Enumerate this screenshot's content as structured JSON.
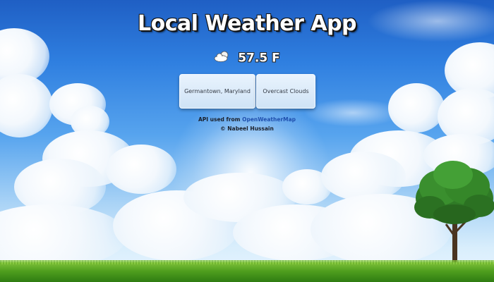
{
  "app": {
    "title": "Local Weather App"
  },
  "weather": {
    "icon": "partly-cloudy-icon",
    "temperature": "57.5 F",
    "location": "Germantown, Maryland",
    "conditions": "Overcast Clouds"
  },
  "footer": {
    "api_prefix": "API used from",
    "api_link": "OpenWeatherMap",
    "copyright": "© Nabeel Hussain"
  },
  "colors": {
    "sky_top": "#1f5fc4",
    "sky_bottom": "#eaf6ff",
    "grass": "#4f9e1e",
    "card_bg": "#dbeaf8",
    "link": "#1f4fae"
  }
}
